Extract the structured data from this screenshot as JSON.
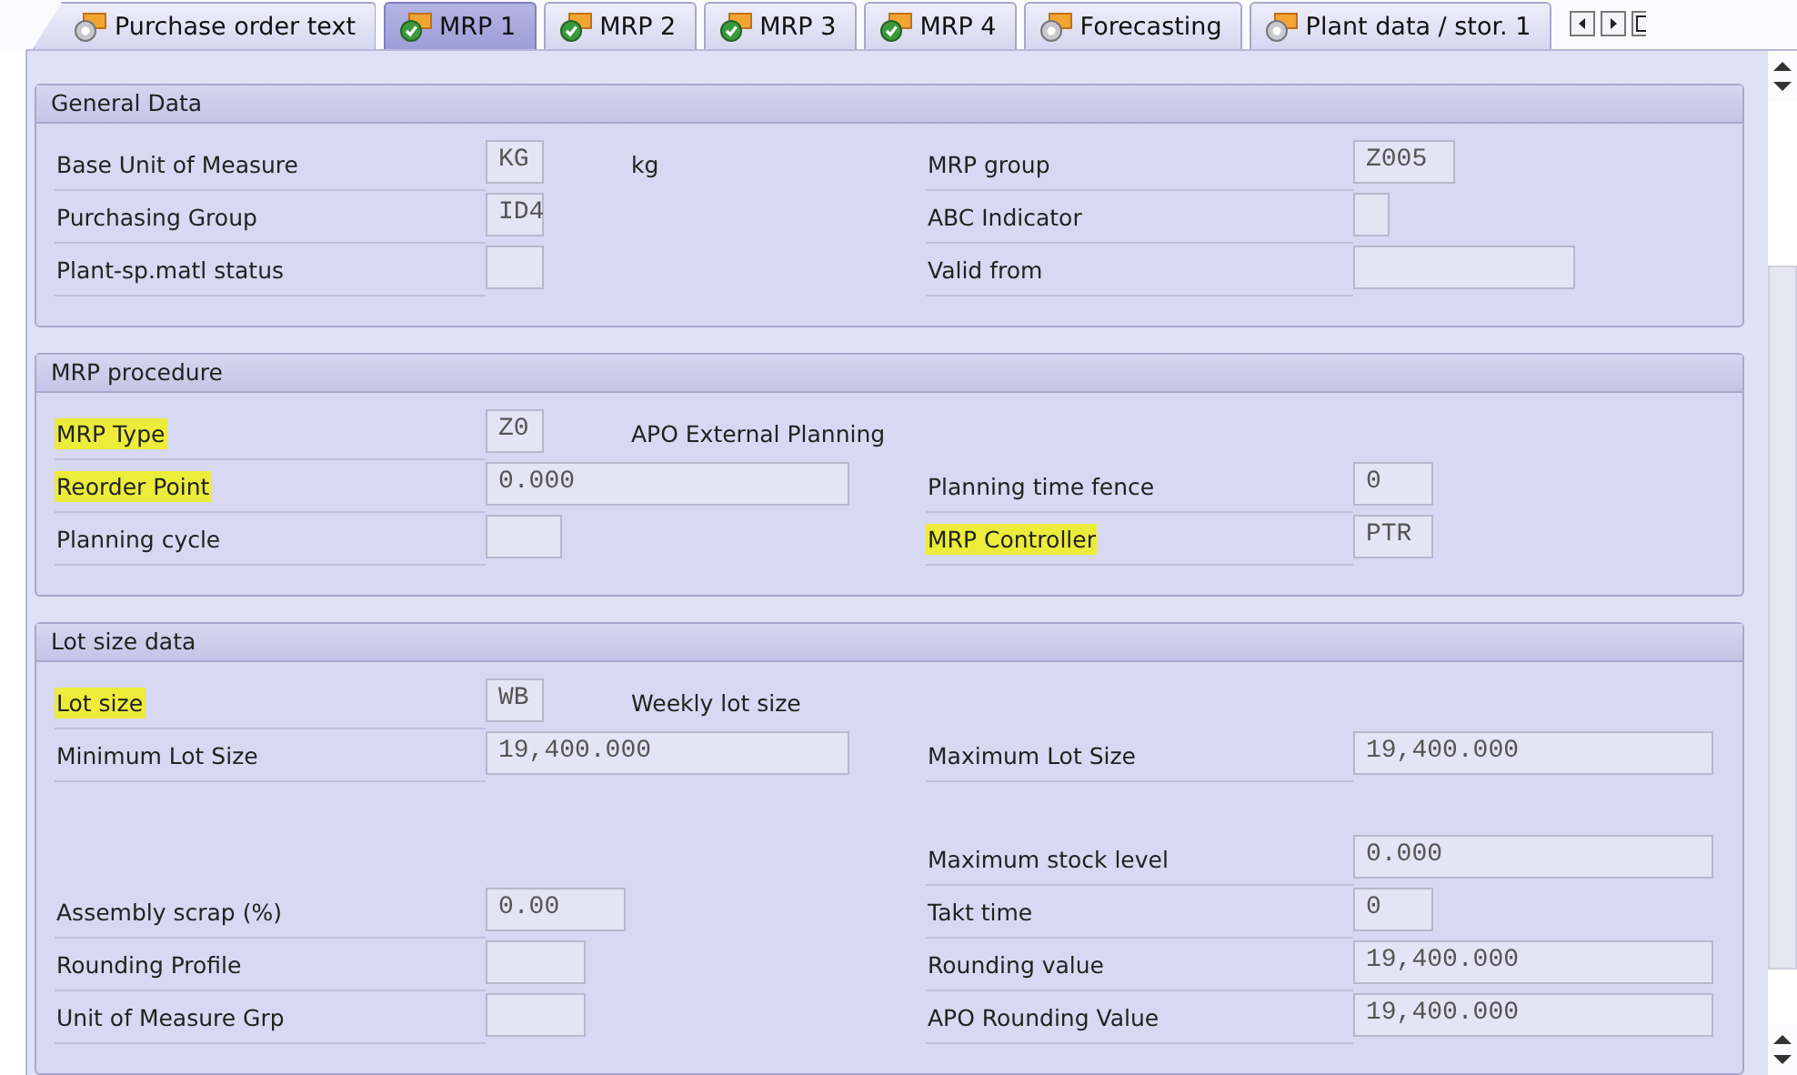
{
  "tabs": [
    {
      "label": "Purchase order text",
      "checked": false,
      "selected": false
    },
    {
      "label": "MRP 1",
      "checked": true,
      "selected": true
    },
    {
      "label": "MRP 2",
      "checked": true,
      "selected": false
    },
    {
      "label": "MRP 3",
      "checked": true,
      "selected": false
    },
    {
      "label": "MRP 4",
      "checked": true,
      "selected": false
    },
    {
      "label": "Forecasting",
      "checked": false,
      "selected": false
    },
    {
      "label": "Plant data / stor. 1",
      "checked": false,
      "selected": false
    }
  ],
  "sections": [
    {
      "title": "General Data",
      "rows": [
        {
          "left": {
            "label": "Base Unit of Measure",
            "highlighted": false,
            "value": "KG",
            "description": "kg"
          },
          "right": {
            "label": "MRP group",
            "highlighted": false,
            "value": "Z005"
          }
        },
        {
          "left": {
            "label": "Purchasing Group",
            "highlighted": false,
            "value": "ID4"
          },
          "right": {
            "label": "ABC Indicator",
            "highlighted": false
          }
        },
        {
          "left": {
            "label": "Plant-sp.matl status",
            "highlighted": false
          },
          "right": {
            "label": "Valid from",
            "highlighted": false
          }
        }
      ]
    },
    {
      "title": "MRP procedure",
      "rows": [
        {
          "left": {
            "label": "MRP Type",
            "highlighted": true,
            "value": "Z0",
            "description": "APO External Planning"
          }
        },
        {
          "left": {
            "label": "Reorder Point",
            "highlighted": true,
            "value": "0.000"
          },
          "right": {
            "label": "Planning time fence",
            "highlighted": false,
            "value": "0"
          }
        },
        {
          "left": {
            "label": "Planning cycle",
            "highlighted": false
          },
          "right": {
            "label": "MRP Controller",
            "highlighted": true,
            "value": "PTR"
          }
        }
      ]
    },
    {
      "title": "Lot size data",
      "rows": [
        {
          "left": {
            "label": "Lot size",
            "highlighted": true,
            "value": "WB",
            "description": "Weekly lot size"
          }
        },
        {
          "left": {
            "label": "Minimum Lot Size",
            "highlighted": false,
            "value": "19,400.000"
          },
          "right": {
            "label": "Maximum Lot Size",
            "highlighted": false,
            "value": "19,400.000"
          }
        },
        {
          "right": {
            "label": "Maximum stock level",
            "highlighted": false,
            "value": "0.000"
          }
        },
        {
          "left": {
            "label": "Assembly scrap (%)",
            "highlighted": false,
            "value": "0.00"
          },
          "right": {
            "label": "Takt time",
            "highlighted": false,
            "value": "0"
          }
        },
        {
          "left": {
            "label": "Rounding Profile",
            "highlighted": false
          },
          "right": {
            "label": "Rounding value",
            "highlighted": false,
            "value": "19,400.000"
          }
        },
        {
          "left": {
            "label": "Unit of Measure Grp",
            "highlighted": false
          },
          "right": {
            "label": "APO Rounding Value",
            "highlighted": false,
            "value": "19,400.000"
          }
        }
      ]
    }
  ]
}
